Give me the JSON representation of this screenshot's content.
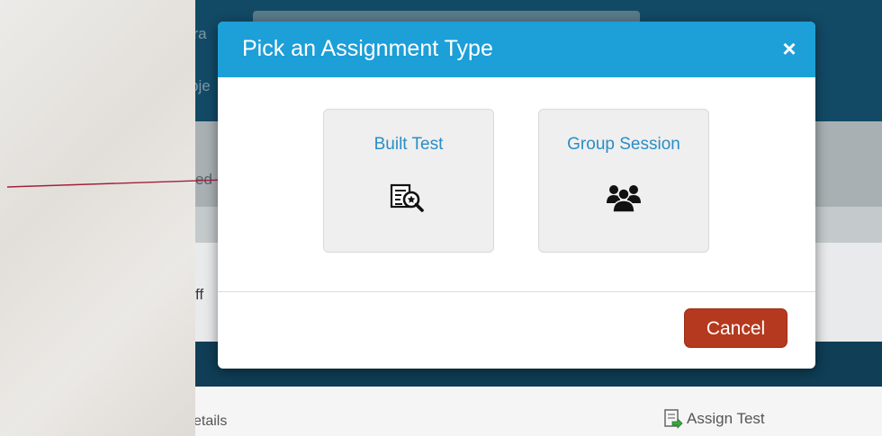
{
  "background_app": {
    "fragments": {
      "program": "gra",
      "objective": "bje",
      "partial_ed": "ed",
      "partial_ff": "ff",
      "details": "etails"
    },
    "assign_test_label": "Assign Test",
    "assign_icon": "assign-test-icon"
  },
  "modal": {
    "title": "Pick an Assignment Type",
    "close_symbol": "×",
    "options": [
      {
        "label": "Built Test",
        "icon": "document-search-icon"
      },
      {
        "label": "Group Session",
        "icon": "group-users-icon"
      }
    ],
    "cancel_label": "Cancel"
  },
  "colors": {
    "header_blue": "#1d9fd8",
    "link_blue": "#2a8dc6",
    "cancel_red": "#b5391e",
    "arrow_red": "#a3213a",
    "app_dark": "#124a66"
  }
}
